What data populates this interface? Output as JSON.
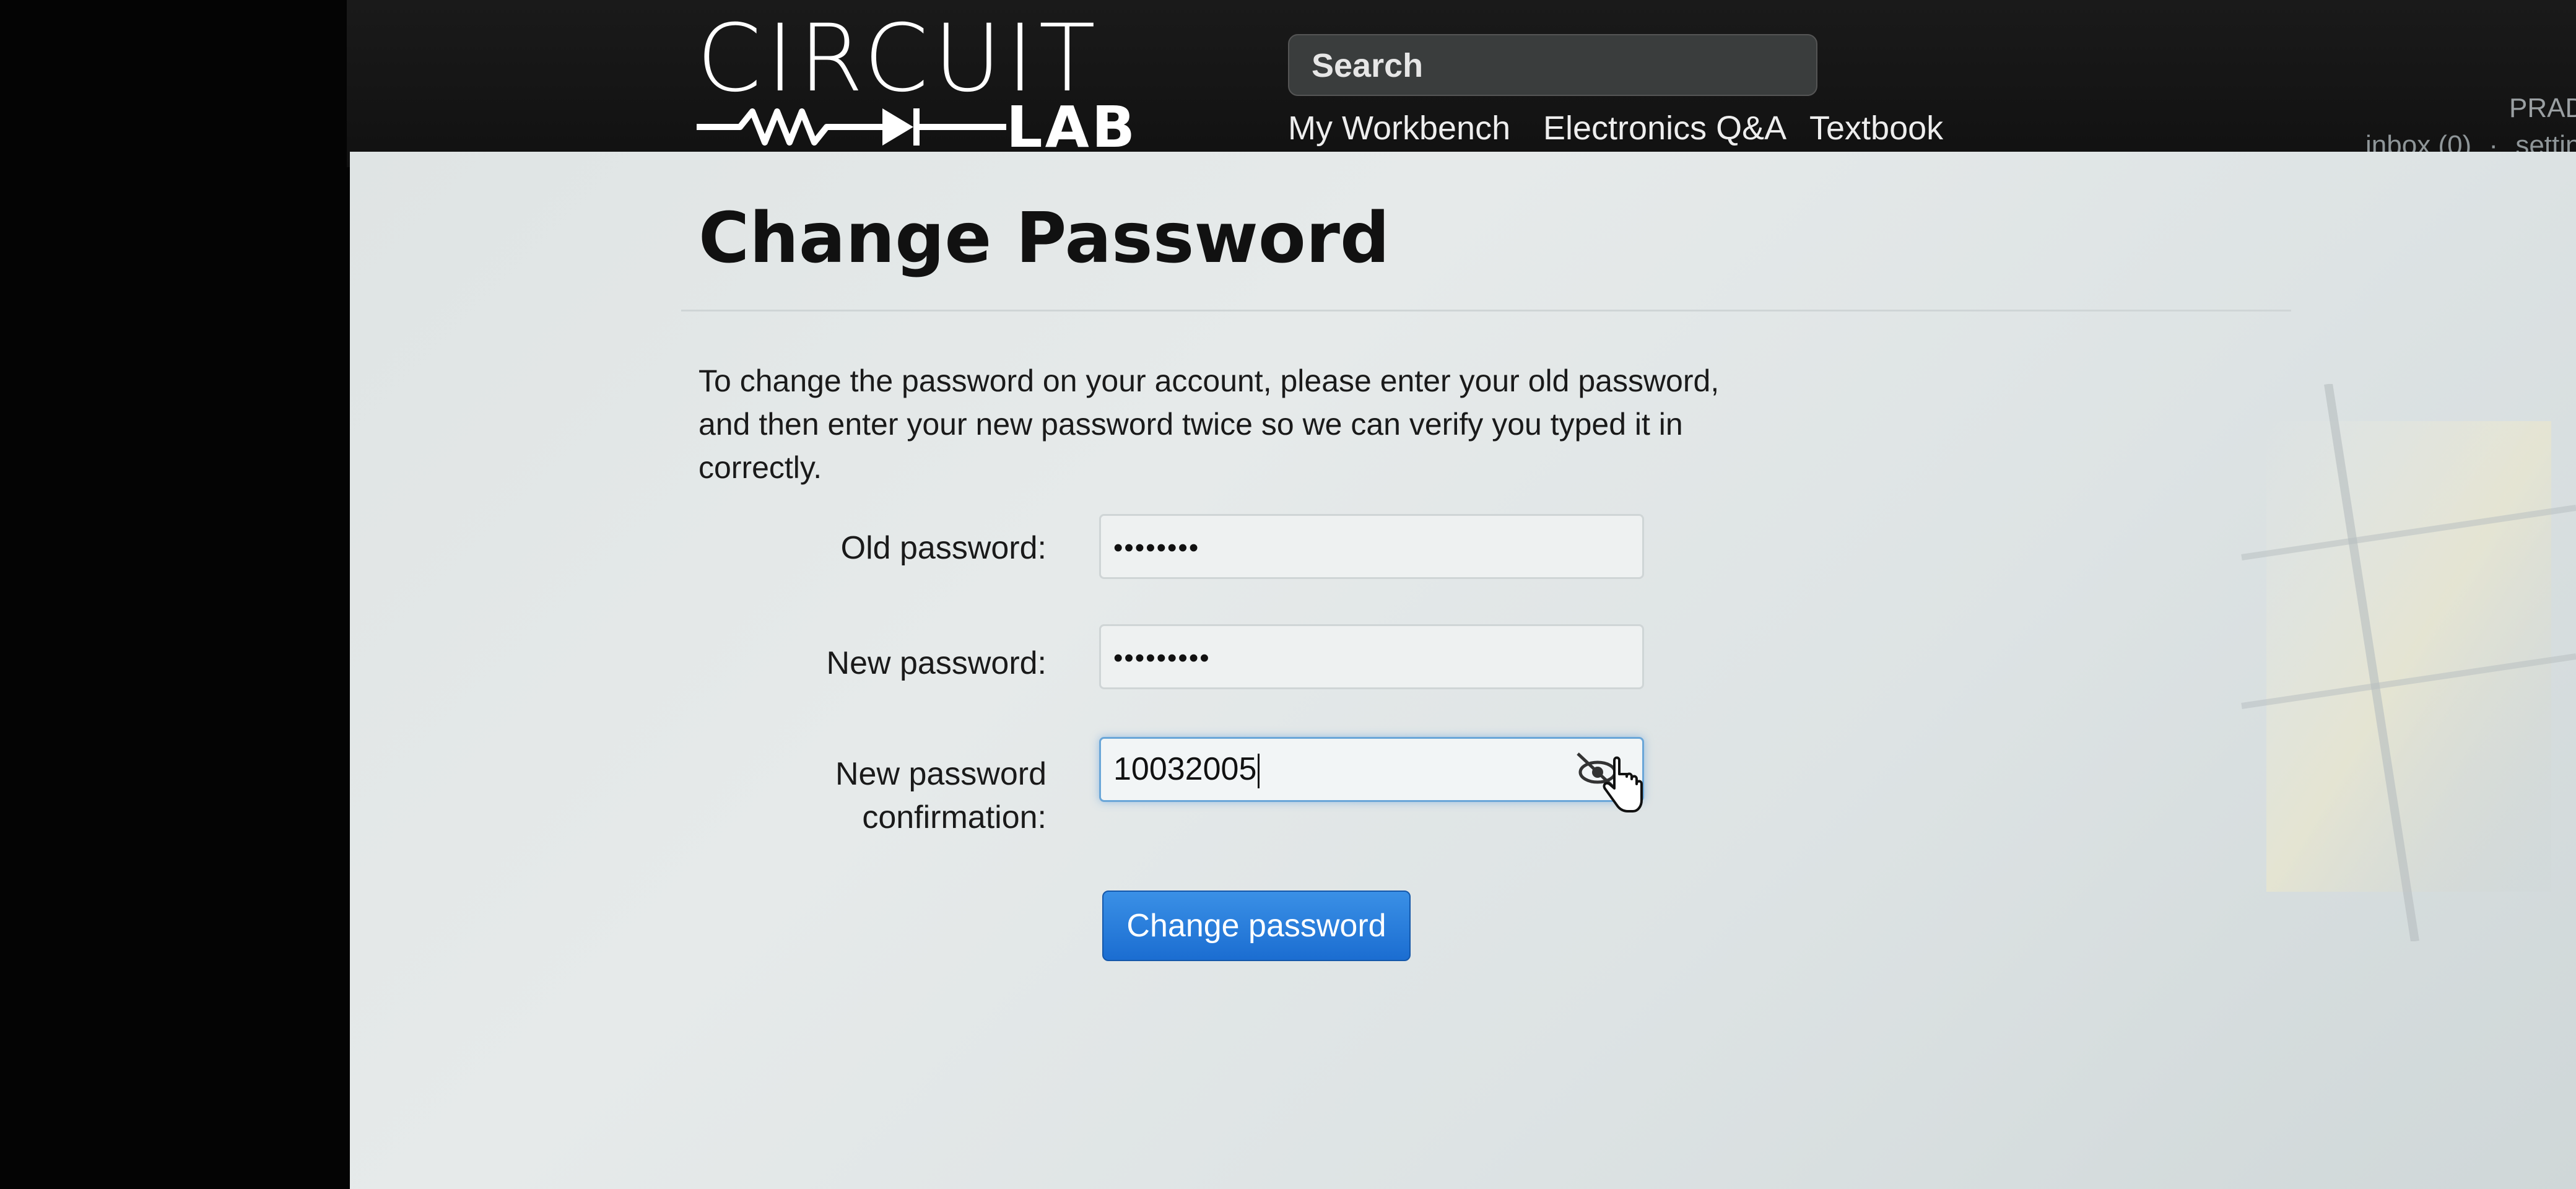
{
  "brand": {
    "logo_top": "CIRCUIT",
    "logo_bottom": "LAB"
  },
  "header": {
    "search_placeholder": "Search",
    "nav": [
      {
        "label": "My Workbench"
      },
      {
        "label": "Electronics Q&A"
      },
      {
        "label": "Textbook"
      }
    ],
    "user_name": "PRAD",
    "inbox_label": "inbox (0)",
    "separator": "·",
    "settings_label": "setting"
  },
  "main": {
    "title": "Change Password",
    "intro_lines": [
      "To change the password on your account, please enter your old password,",
      "and then enter your new password twice so we can verify you typed it in",
      "correctly."
    ],
    "form": {
      "old_password_label": "Old password:",
      "old_password_value": "••••••••",
      "new_password_label": "New password:",
      "new_password_value": "•••••••••",
      "confirm_label_line1": "New password",
      "confirm_label_line2": "confirmation:",
      "confirm_value": "10032005",
      "submit_label": "Change password"
    }
  },
  "colors": {
    "navbar": "#111111",
    "page": "#e3e7e7",
    "button": "#2a7fdc",
    "focus_ring": "#6aa6d8"
  },
  "icons": {
    "password_toggle": "eye-slash-icon",
    "cursor": "hand-cursor-icon"
  }
}
